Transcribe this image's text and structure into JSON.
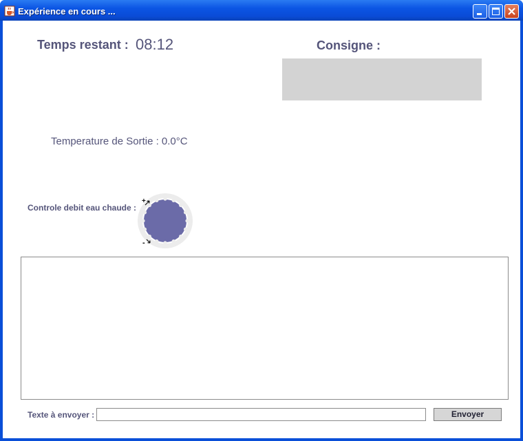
{
  "window": {
    "title": "Expérience en cours ...",
    "icon": "java-cup-icon"
  },
  "timer": {
    "label": "Temps restant :",
    "value": "08:12"
  },
  "consigne": {
    "label": "Consigne :",
    "text": ""
  },
  "temperature": {
    "text": "Temperature de Sortie : 0.0°C"
  },
  "control": {
    "label": "Controle debit eau chaude :",
    "plus": "+",
    "minus": "-",
    "knob_color": "#6b6ba8"
  },
  "log": {
    "content": ""
  },
  "send": {
    "label": "Texte à envoyer :",
    "value": "",
    "button_label": "Envoyer"
  },
  "colors": {
    "label_text": "#55557a",
    "titlebar": "#0a4fd8",
    "consigne_box": "#d3d3d3"
  }
}
